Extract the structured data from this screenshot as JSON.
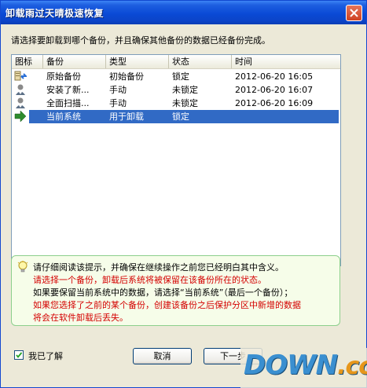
{
  "window": {
    "title": "卸载雨过天晴极速恢复"
  },
  "instruction": "请选择要卸载到哪个备份，并且确保其他备份的数据已经备份完成。",
  "table": {
    "headers": [
      "图标",
      "备份",
      "类型",
      "状态",
      "时间"
    ],
    "rows": [
      {
        "icon": "restore-backup-icon",
        "name": "原始备份",
        "type": "初始备份",
        "status": "锁定",
        "time": "2012-06-20 16:05"
      },
      {
        "icon": "user-backup-icon",
        "name": "安装了新...",
        "type": "手动",
        "status": "未锁定",
        "time": "2012-06-20 16:07"
      },
      {
        "icon": "user-backup-icon",
        "name": "全面扫描...",
        "type": "手动",
        "status": "未锁定",
        "time": "2012-06-20 16:09"
      },
      {
        "icon": "current-system-arrow-icon",
        "name": "当前系统",
        "type": "用于卸载",
        "status": "锁定",
        "time": "",
        "selected": true
      }
    ]
  },
  "notice": {
    "line1": "请仔细阅读该提示，并确保在继续操作之前您已经明白其中含义。",
    "line2": "请选择一个备份，卸载后系统将被保留在该备份所在的状态。",
    "line3": "如果要保留当前系统中的数据，请选择“当前系统”（最后一个备份）；",
    "line4": "如果您选择了之前的某个备份，创建该备份之后保护分区中新增的数据",
    "line5": "将会在软件卸载后丢失。"
  },
  "confirm": {
    "label": "我已了解",
    "checked": true
  },
  "buttons": {
    "cancel": "取消",
    "next": "下一步"
  },
  "watermark": {
    "main": "DOWN",
    "suffix": ".cc"
  }
}
